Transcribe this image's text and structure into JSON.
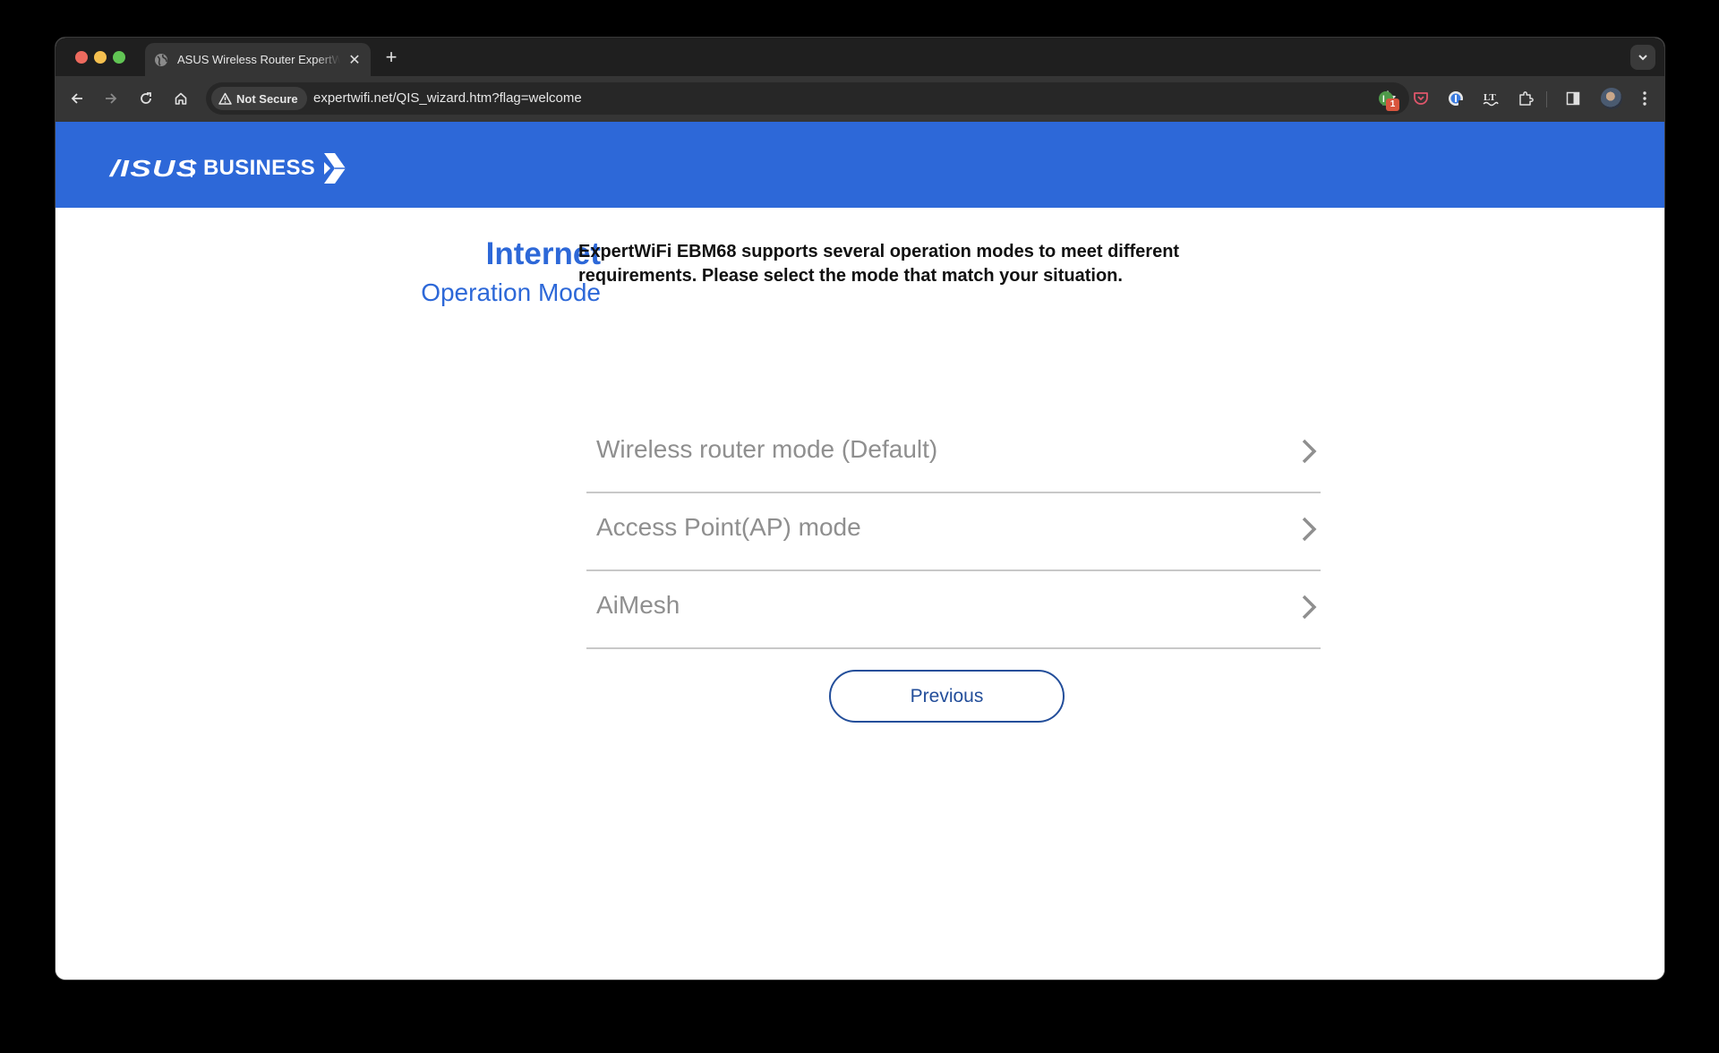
{
  "browser": {
    "tab": {
      "title": "ASUS Wireless Router ExpertWiFi",
      "icon": "globe-icon"
    },
    "new_tab_label": "+",
    "address": {
      "security_label": "Not Secure",
      "url": "expertwifi.net/QIS_wizard.htm?flag=welcome"
    },
    "extensions": [
      {
        "name": "extension-green-icon",
        "badge": "1"
      },
      {
        "name": "pocket-icon"
      },
      {
        "name": "extension-blue-icon"
      },
      {
        "name": "languagetool-icon"
      },
      {
        "name": "extensions-puzzle-icon"
      }
    ]
  },
  "header": {
    "brand": "/ISUS",
    "product_line": "BUSINESS"
  },
  "sidebar": {
    "title": "Internet",
    "subtitle": "Operation Mode"
  },
  "main": {
    "description": "ExpertWiFi EBM68 supports several operation modes to meet different requirements. Please select the mode that match your situation.",
    "modes": [
      {
        "label": "Wireless router mode (Default)"
      },
      {
        "label": "Access Point(AP) mode"
      },
      {
        "label": "AiMesh"
      }
    ],
    "previous_label": "Previous"
  },
  "colors": {
    "brand_blue": "#2d68d8",
    "button_blue": "#234e9a",
    "mode_text": "#8f8f8f"
  }
}
